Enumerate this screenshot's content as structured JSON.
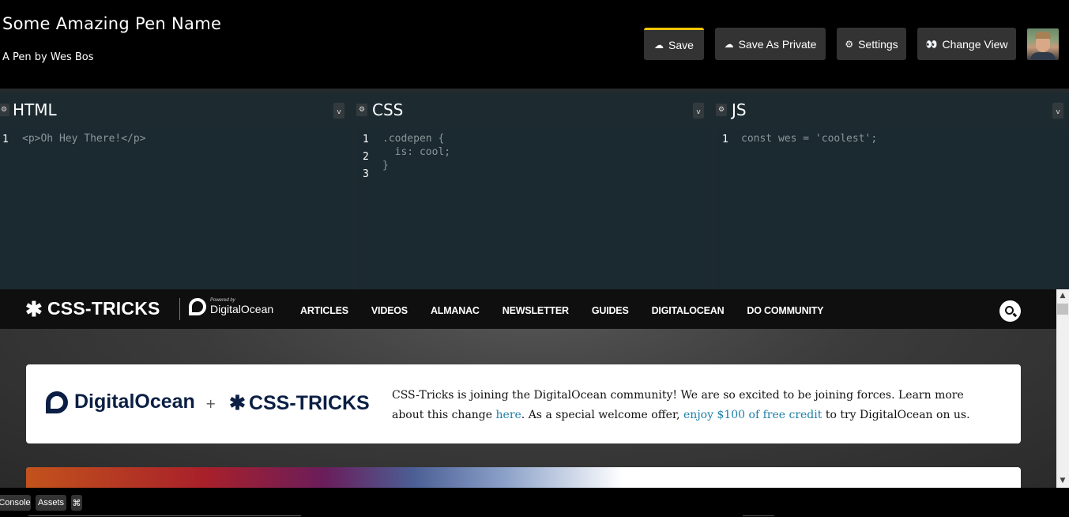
{
  "header": {
    "pen_title": "Some Amazing Pen Name",
    "pen_author": "A Pen by Wes Bos",
    "buttons": {
      "save": "Save",
      "save_private": "Save As Private",
      "settings": "Settings",
      "change_view": "Change View"
    },
    "icons": {
      "save": "☁",
      "save_private": "☁",
      "settings": "⚙",
      "change_view": "👀"
    }
  },
  "editors": [
    {
      "name": "HTML",
      "line_numbers": [
        "1"
      ],
      "code": "<p>Oh Hey There!</p>"
    },
    {
      "name": "CSS",
      "line_numbers": [
        "1",
        "2",
        "3"
      ],
      "code": ".codepen {\n  is: cool;\n}"
    },
    {
      "name": "JS",
      "line_numbers": [
        "1"
      ],
      "code": "const wes = 'coolest';"
    }
  ],
  "editor_gear_glyph": "⚙",
  "editor_toggle_glyph": "v",
  "preview": {
    "site_logo": "CSS-TRICKS",
    "logo_star": "✱",
    "powered_by": "Powered by",
    "partner_name": "DigitalOcean",
    "nav": [
      "ARTICLES",
      "VIDEOS",
      "ALMANAC",
      "NEWSLETTER",
      "GUIDES",
      "DIGITALOCEAN",
      "DO COMMUNITY"
    ],
    "banner": {
      "do_name": "DigitalOcean",
      "plus": "+",
      "ct_name": "CSS-TRICKS",
      "text_1": "CSS-Tricks is joining the DigitalOcean community! We are so excited to be joining forces. Learn more about this change ",
      "link_1": "here",
      "text_2": ". As a special welcome offer, ",
      "link_2": "enjoy $100 of free credit",
      "text_3": " to try DigitalOcean on us."
    },
    "scroll_up": "▲",
    "scroll_down": "▼"
  },
  "footer": {
    "console": "Console",
    "assets": "Assets",
    "keys": "⌘"
  },
  "colors": {
    "accent": "#f7c600",
    "editor_bg": "#1d2b31",
    "link": "#1b7fa6",
    "brand_navy": "#0b1f44"
  }
}
